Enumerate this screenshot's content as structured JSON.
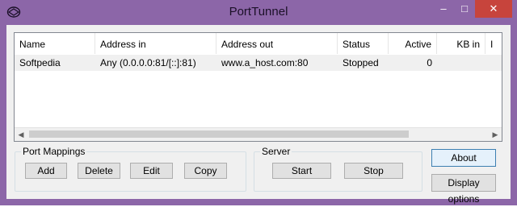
{
  "window": {
    "title": "PortTunnel",
    "controls": {
      "minimize": "‒",
      "maximize": "□",
      "close": "✕"
    }
  },
  "list": {
    "columns": [
      "Name",
      "Address in",
      "Address out",
      "Status",
      "Active",
      "KB in",
      "I"
    ],
    "rows": [
      {
        "name": "Softpedia",
        "address_in": "Any (0.0.0.0:81/[::]:81)",
        "address_out": "www.a_host.com:80",
        "status": "Stopped",
        "active": "0",
        "kb_in": ""
      }
    ]
  },
  "port_mappings": {
    "label": "Port Mappings",
    "buttons": {
      "add": "Add",
      "delete": "Delete",
      "edit": "Edit",
      "copy": "Copy"
    }
  },
  "server": {
    "label": "Server",
    "buttons": {
      "start": "Start",
      "stop": "Stop"
    }
  },
  "side_buttons": {
    "about": "About",
    "display_options": "Display options"
  },
  "colors": {
    "frame": "#8c66a8",
    "close": "#c7443c",
    "selected_row": "#f0f0f0"
  }
}
